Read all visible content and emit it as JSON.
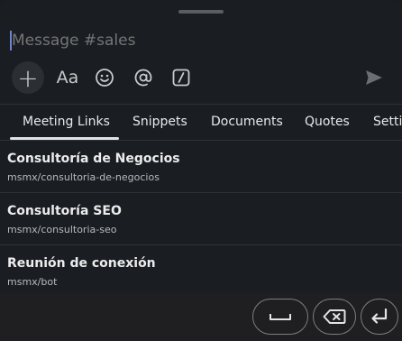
{
  "composer": {
    "placeholder": "Message #sales",
    "tools": {
      "add": "+",
      "format": "Aa",
      "emoji_icon": "smiley-icon",
      "mention_icon": "at-icon",
      "slash_icon": "slash-command-icon",
      "send_icon": "send-icon"
    }
  },
  "tabs": {
    "items": [
      {
        "label": "Meeting Links",
        "active": true
      },
      {
        "label": "Snippets",
        "active": false
      },
      {
        "label": "Documents",
        "active": false
      },
      {
        "label": "Quotes",
        "active": false
      },
      {
        "label": "Setti",
        "active": false
      }
    ]
  },
  "links": [
    {
      "title": "Consultoría de Negocios",
      "url": "msmx/consultoria-de-negocios"
    },
    {
      "title": "Consultoría SEO",
      "url": "msmx/consultoria-seo"
    },
    {
      "title": "Reunión de conexión",
      "url": "msmx/bot"
    }
  ],
  "keyboard": {
    "keys": [
      "space-key",
      "backspace-key",
      "enter-key"
    ]
  },
  "colors": {
    "sheet_background": "#1a1d21",
    "active_tab_indicator": "#dfe3ea",
    "caret": "#6e83d6"
  }
}
